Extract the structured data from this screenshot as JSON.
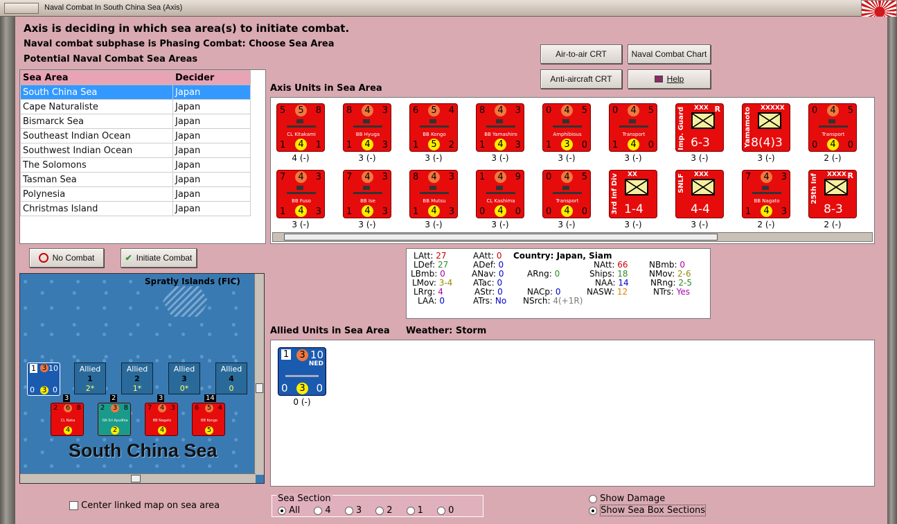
{
  "window": {
    "title": "Naval Combat In South China Sea (Axis)"
  },
  "header": {
    "line1": "Axis is deciding in which sea area(s) to initiate combat.",
    "line2": "Naval combat subphase is Phasing Combat: Choose Sea Area",
    "line3": "Potential Naval Combat Sea Areas"
  },
  "buttons": {
    "air_to_air": "Air-to-air CRT",
    "naval_chart": "Naval Combat Chart",
    "anti_aircraft": "Anti-aircraft CRT",
    "help": "Help",
    "no_combat": "No Combat",
    "initiate_combat": "Initiate Combat"
  },
  "sea_table": {
    "col_area": "Sea Area",
    "col_decider": "Decider",
    "rows": [
      {
        "area": "South China Sea",
        "decider": "Japan"
      },
      {
        "area": "Cape Naturaliste",
        "decider": "Japan"
      },
      {
        "area": "Bismarck Sea",
        "decider": "Japan"
      },
      {
        "area": "Southeast Indian Ocean",
        "decider": "Japan"
      },
      {
        "area": "Southwest Indian Ocean",
        "decider": "Japan"
      },
      {
        "area": "The Solomons",
        "decider": "Japan"
      },
      {
        "area": "Tasman Sea",
        "decider": "Japan"
      },
      {
        "area": "Polynesia",
        "decider": "Japan"
      },
      {
        "area": "Christmas Island",
        "decider": "Japan"
      }
    ]
  },
  "axis_label": "Axis Units in Sea Area",
  "axis_units": [
    {
      "tl": "5",
      "tc": "5",
      "tr": "8",
      "bl": "1",
      "bc": "4",
      "br": "1",
      "name": "CL Kitakami",
      "lbl": "4 (-)"
    },
    {
      "tl": "8",
      "tc": "4",
      "tr": "3",
      "bl": "1",
      "bc": "4",
      "br": "3",
      "name": "BB Hyuga",
      "lbl": "3 (-)"
    },
    {
      "tl": "6",
      "tc": "5",
      "tr": "4",
      "bl": "1",
      "bc": "5",
      "br": "2",
      "name": "BB Kongo",
      "lbl": "3 (-)"
    },
    {
      "tl": "8",
      "tc": "4",
      "tr": "3",
      "bl": "1",
      "bc": "4",
      "br": "3",
      "name": "BB Yamashiro",
      "lbl": "3 (-)"
    },
    {
      "tl": "0",
      "tc": "4",
      "tr": "5",
      "bl": "1",
      "bc": "3",
      "br": "0",
      "name": "Amphibious",
      "lbl": "3 (-)"
    },
    {
      "tl": "0",
      "tc": "4",
      "tr": "5",
      "bl": "1",
      "bc": "4",
      "br": "0",
      "name": "Transport",
      "lbl": "3 (-)"
    },
    {
      "tl": "",
      "tc": "",
      "tr": "R",
      "bl": "",
      "bc": "",
      "br": "",
      "name": "XXX",
      "big": "6-3",
      "side": "Imp. Guard",
      "land": true,
      "lbl": "3 (-)"
    },
    {
      "tl": "",
      "tc": "",
      "tr": "",
      "bl": "",
      "bc": "",
      "br": "",
      "name": "XXXXX",
      "big": "8(4)3",
      "side": "Yamamoto",
      "land": true,
      "lbl": "3 (-)"
    },
    {
      "tl": "0",
      "tc": "4",
      "tr": "5",
      "bl": "0",
      "bc": "4",
      "br": "0",
      "name": "Transport",
      "lbl": "2 (-)"
    },
    {
      "tl": "7",
      "tc": "4",
      "tr": "3",
      "bl": "1",
      "bc": "4",
      "br": "3",
      "name": "BB Fuso",
      "lbl": "3 (-)"
    },
    {
      "tl": "7",
      "tc": "4",
      "tr": "3",
      "bl": "1",
      "bc": "4",
      "br": "3",
      "name": "BB Ise",
      "lbl": "3 (-)"
    },
    {
      "tl": "8",
      "tc": "4",
      "tr": "3",
      "bl": "1",
      "bc": "4",
      "br": "3",
      "name": "BB Mutsu",
      "lbl": "3 (-)"
    },
    {
      "tl": "1",
      "tc": "4",
      "tr": "9",
      "bl": "0",
      "bc": "4",
      "br": "0",
      "name": "CL Kashima",
      "lbl": "3 (-)"
    },
    {
      "tl": "0",
      "tc": "4",
      "tr": "5",
      "bl": "0",
      "bc": "4",
      "br": "0",
      "name": "Transport",
      "lbl": "3 (-)"
    },
    {
      "tl": "",
      "tc": "",
      "tr": "",
      "bl": "",
      "bc": "",
      "br": "",
      "name": "XX",
      "big": "1-4",
      "side": "3rd Inf Div",
      "land": true,
      "lbl": "3 (-)"
    },
    {
      "tl": "",
      "tc": "",
      "tr": "",
      "bl": "",
      "bc": "",
      "br": "",
      "name": "XXX",
      "big": "4-4",
      "side": "SNLF",
      "land": true,
      "lbl": "3 (-)"
    },
    {
      "tl": "7",
      "tc": "4",
      "tr": "3",
      "bl": "1",
      "bc": "4",
      "br": "3",
      "name": "BB Nagato",
      "lbl": "2 (-)"
    },
    {
      "tl": "",
      "tc": "",
      "tr": "R",
      "bl": "",
      "bc": "",
      "br": "",
      "name": "XXXX",
      "big": "8-3",
      "side": "25th Inf",
      "land": true,
      "lbl": "2 (-)"
    }
  ],
  "stats": {
    "country": "Country: Japan, Siam",
    "LAtt": "27",
    "LDef": "27",
    "LBmb": "0",
    "LMov": "3-4",
    "LRrg": "4",
    "LAA": "0",
    "AAtt": "0",
    "ADef": "0",
    "ANav": "0",
    "ATac": "0",
    "AStr": "0",
    "ATrs": "No",
    "ARng": "0",
    "NACp": "0",
    "NSrch": "4(+1R)",
    "NAtt": "66",
    "Ships": "18",
    "NAA": "14",
    "NASW": "12",
    "NBmb": "0",
    "NMov": "2-6",
    "NRng": "2-5",
    "NTrs": "Yes"
  },
  "allied_label": "Allied Units in Sea Area",
  "weather": "Weather:  Storm",
  "allied_unit": {
    "tl": "1",
    "tc": "3",
    "tr": "10",
    "tag": "NED",
    "bl": "0",
    "bc": "3",
    "br": "0",
    "lbl": "0 (-)"
  },
  "map": {
    "islands": "Spratly Islands (FIC)",
    "sea_name": "South China Sea",
    "boxes": [
      {
        "title": "Allied",
        "num": "1",
        "val": "2*"
      },
      {
        "title": "Allied",
        "num": "2",
        "val": "1*"
      },
      {
        "title": "Allied",
        "num": "3",
        "val": "0*"
      },
      {
        "title": "Allied",
        "num": "4",
        "val": "0"
      }
    ],
    "counters": [
      {
        "top": "3",
        "name": "CL Naka",
        "a": "2",
        "b": "6",
        "c": "8",
        "d": "4"
      },
      {
        "top": "2",
        "name": "OA Sri Ayudhia",
        "a": "2",
        "b": "3",
        "c": "8",
        "d": "2"
      },
      {
        "top": "3",
        "name": "BB Nagato",
        "a": "7",
        "b": "4",
        "c": "3",
        "d": "4"
      },
      {
        "top": "14",
        "name": "BB Kongo",
        "a": "6",
        "b": "5",
        "c": "4",
        "d": "5"
      }
    ],
    "center_linked": "Center linked map on sea area"
  },
  "sea_section": {
    "label": "Sea Section",
    "options": [
      "All",
      "4",
      "3",
      "2",
      "1",
      "0"
    ],
    "selected": "All"
  },
  "options": {
    "show_damage": "Show Damage",
    "show_sections": "Show Sea Box Sections"
  }
}
